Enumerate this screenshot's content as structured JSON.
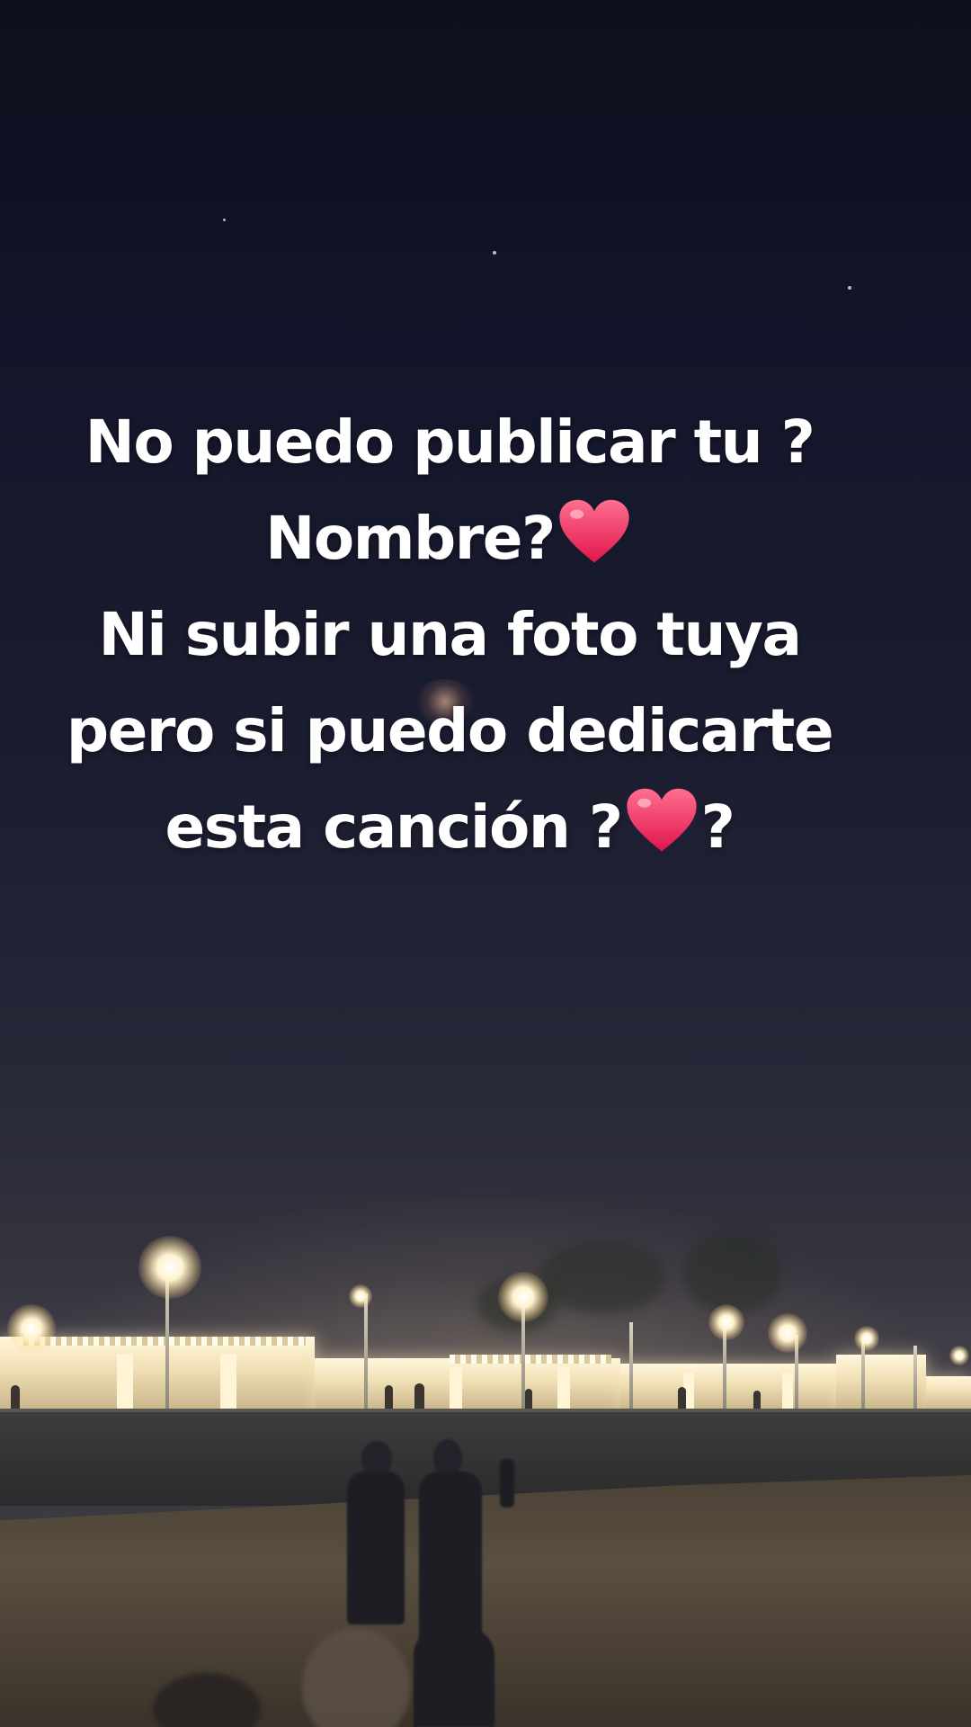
{
  "caption": {
    "line1": "No puedo publicar tu ?",
    "line2": "Nombre?",
    "line3": "Ni subir una foto tuya",
    "line4": "pero si puedo dedicarte",
    "line5_before": "esta canción ?",
    "line5_after": "?"
  },
  "icons": {
    "heart": "red-heart-emoji"
  },
  "colors": {
    "caption_text": "#ffffff",
    "heart": "#f0245c",
    "sky_top": "#0d0f1d",
    "sky_horizon": "#45424a"
  }
}
